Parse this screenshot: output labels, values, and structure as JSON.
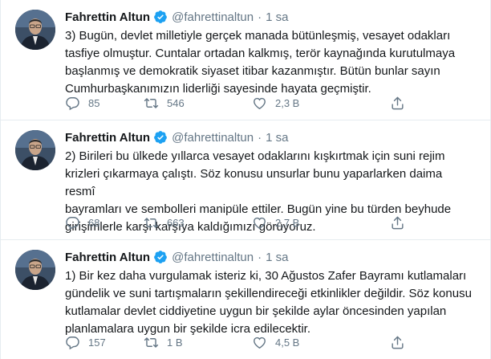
{
  "tweets": [
    {
      "name": "Fahrettin Altun",
      "handle": "@fahrettinaltun",
      "separator": "·",
      "time": "1 sa",
      "text": "3) Bugün, devlet milletiyle gerçek manada bütünleşmiş, vesayet odakları\ntasfiye olmuştur. Cuntalar ortadan kalkmış, terör kaynağında kurutulmaya\nbaşlanmış ve demokratik siyaset itibar kazanmıştır. Bütün bunlar sayın\nCumhurbaşkanımızın liderliği sayesinde hayata geçmiştir.",
      "replies": "85",
      "retweets": "546",
      "likes": "2,3 B"
    },
    {
      "name": "Fahrettin Altun",
      "handle": "@fahrettinaltun",
      "separator": "·",
      "time": "1 sa",
      "text": "2) Birileri bu ülkede yıllarca vesayet odaklarını kışkırtmak için suni rejim\nkrizleri çıkarmaya çalıştı. Söz konusu unsurlar bunu yaparlarken daima resmî\nbayramları ve sembolleri manipüle ettiler. Bugün yine bu türden beyhude\ngirişimlerle karşı karşıya kaldığımızı görüyoruz.",
      "replies": "68",
      "retweets": "663",
      "likes": "2,7 B"
    },
    {
      "name": "Fahrettin Altun",
      "handle": "@fahrettinaltun",
      "separator": "·",
      "time": "1 sa",
      "text": "1) Bir kez daha vurgulamak isteriz ki, 30 Ağustos Zafer Bayramı kutlamaları\ngündelik ve suni tartışmaların şekillendireceği etkinlikler değildir. Söz konusu\nkutlamalar devlet ciddiyetine uygun bir şekilde aylar öncesinden yapılan\nplanlamalara uygun bir şekilde icra edilecektir.",
      "replies": "157",
      "retweets": "1 B",
      "likes": "4,5 B"
    }
  ],
  "icons": {
    "reply": "reply-icon",
    "retweet": "retweet-icon",
    "like": "like-icon",
    "share": "share-icon",
    "verified": "verified-badge-icon"
  },
  "colors": {
    "verified": "#1da1f2",
    "secondary_text": "#657786",
    "divider": "#e6ecf0"
  }
}
